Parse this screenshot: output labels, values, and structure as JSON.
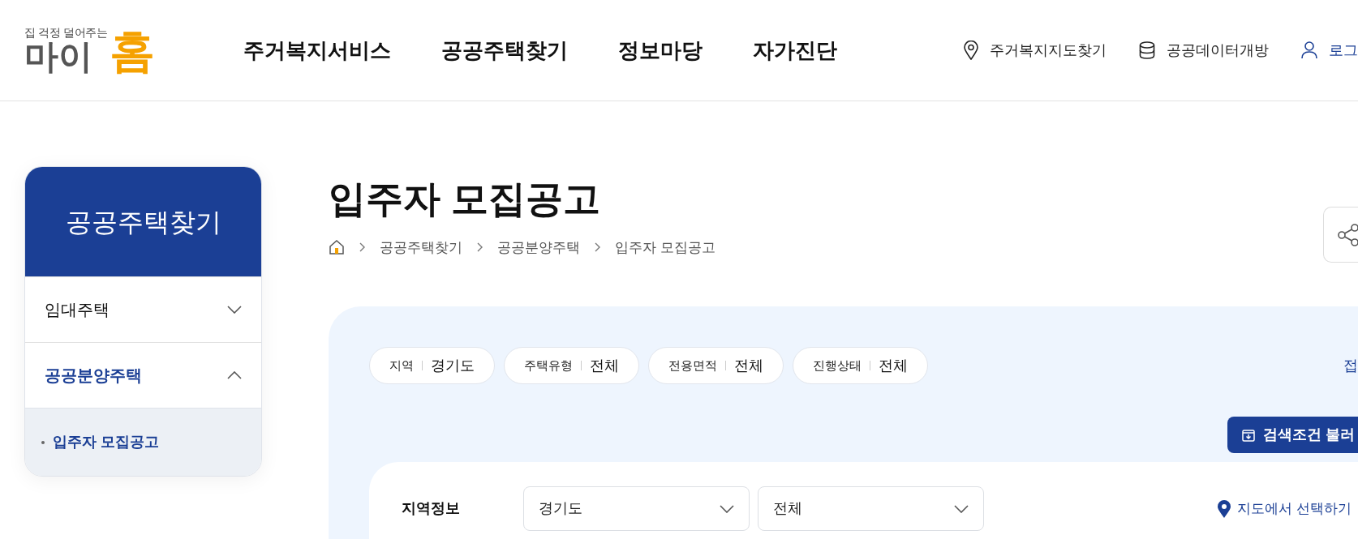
{
  "logo": {
    "tagline": "집 걱정 덜어주는",
    "name": "마이",
    "name_accent": "홈"
  },
  "nav": [
    {
      "label": "주거복지서비스"
    },
    {
      "label": "공공주택찾기"
    },
    {
      "label": "정보마당"
    },
    {
      "label": "자가진단"
    }
  ],
  "utility_links": [
    {
      "kind": "map",
      "label": "주거복지지도찾기"
    },
    {
      "kind": "data",
      "label": "공공데이터개방"
    },
    {
      "kind": "login",
      "label": "로그"
    }
  ],
  "sidebar": {
    "title": "공공주택찾기",
    "items": [
      {
        "label": "임대주택",
        "selected": false,
        "expanded": false
      },
      {
        "label": "공공분양주택",
        "selected": true,
        "expanded": true,
        "children": [
          {
            "label": "입주자 모집공고",
            "selected": true
          }
        ]
      }
    ]
  },
  "page_title": "입주자 모집공고",
  "breadcrumb": [
    "공공주택찾기",
    "공공분양주택",
    "입주자 모집공고"
  ],
  "filter_chips": [
    {
      "label": "지역",
      "value": "경기도"
    },
    {
      "label": "주택유형",
      "value": "전체"
    },
    {
      "label": "전용면적",
      "value": "전체"
    },
    {
      "label": "진행상태",
      "value": "전체"
    }
  ],
  "collapse_link": "접",
  "load_button": "검색조건 불러",
  "region": {
    "label": "지역정보",
    "selects": [
      {
        "value": "경기도"
      },
      {
        "value": "전체"
      }
    ],
    "map_link": "지도에서 선택하기"
  }
}
